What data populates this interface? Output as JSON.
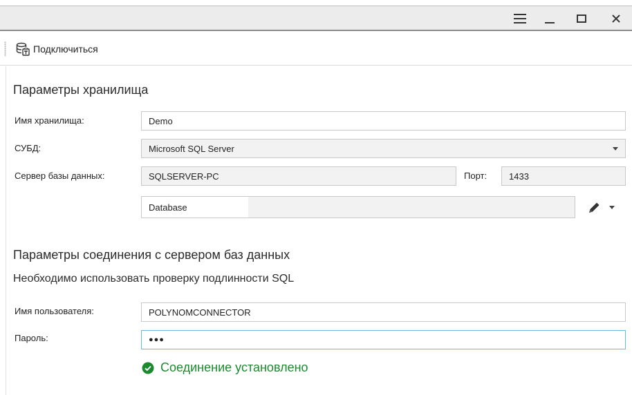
{
  "toolbar": {
    "connect_label": "Подключиться"
  },
  "storage": {
    "section_title": "Параметры хранилища",
    "name_label": "Имя хранилища:",
    "name_value": "Demo",
    "dbms_label": "СУБД:",
    "dbms_value": "Microsoft SQL Server",
    "server_label": "Сервер базы данных:",
    "server_value": "SQLSERVER-PC",
    "port_label": "Порт:",
    "port_value": "1433",
    "database_value": "Database"
  },
  "connection": {
    "section_title": "Параметры соединения с сервером баз данных",
    "auth_text": "Необходимо использовать проверку подлинности SQL",
    "user_label": "Имя пользователя:",
    "user_value": "POLYNOMCONNECTOR",
    "password_label": "Пароль:",
    "password_value": "●●●",
    "status_text": "Соединение установлено"
  },
  "colors": {
    "success": "#1b8a2e",
    "focus_border": "#6ab8dc"
  },
  "icons": [
    "hamburger-menu-icon",
    "minimize-icon",
    "maximize-icon",
    "close-icon",
    "database-connect-icon",
    "pencil-icon",
    "check-circle-icon"
  ]
}
